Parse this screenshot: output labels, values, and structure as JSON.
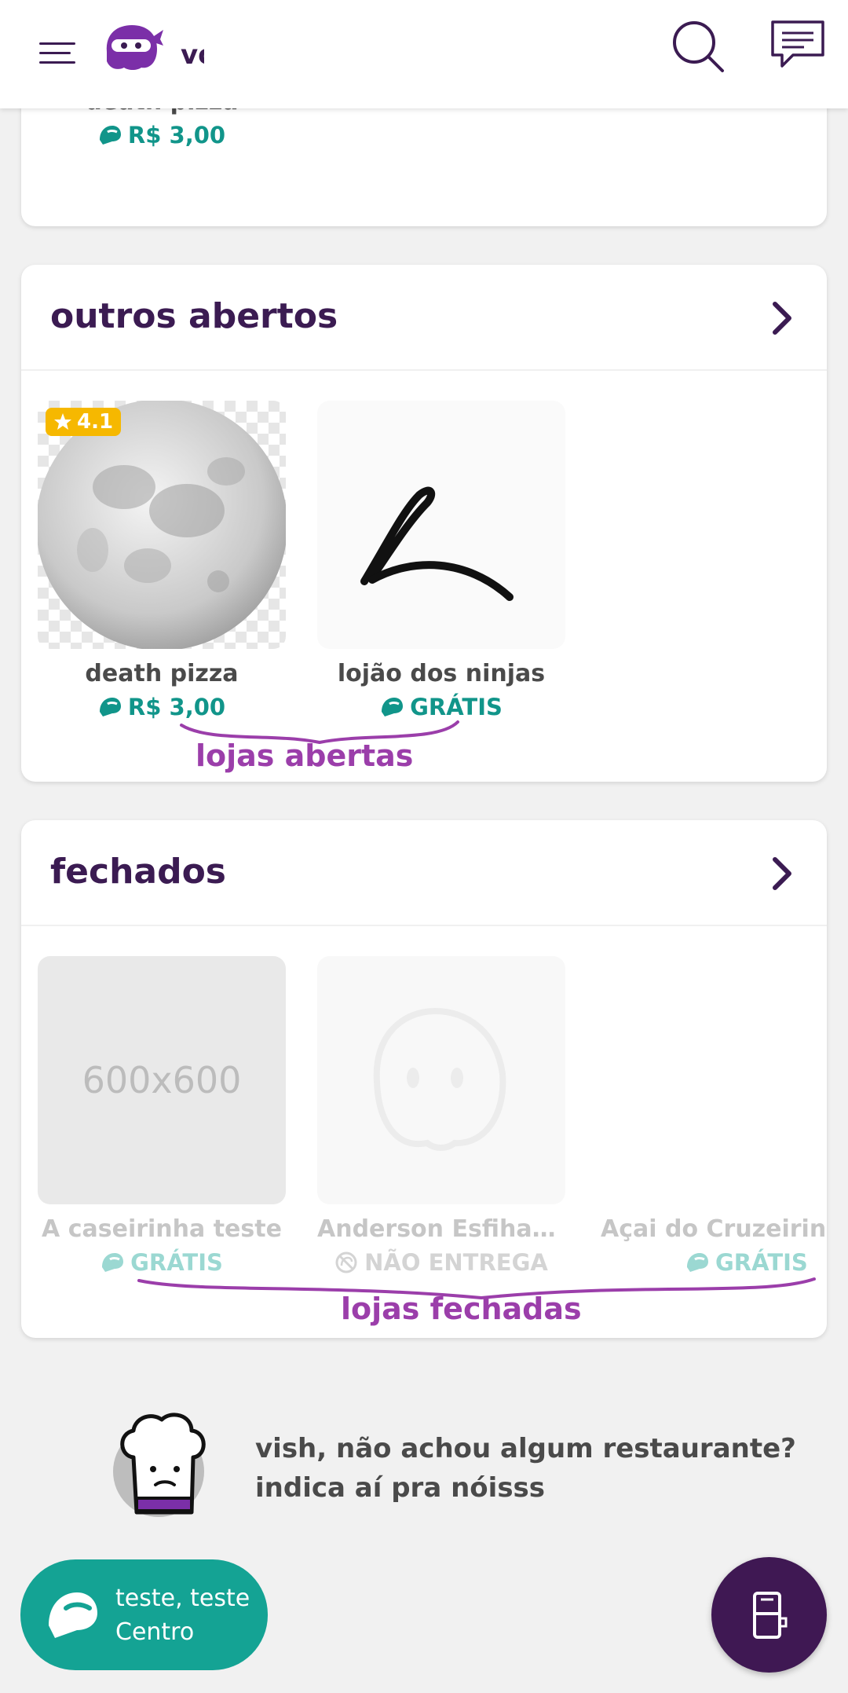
{
  "header": {
    "brand_text": "vo",
    "menu_icon": "hamburger-menu-icon",
    "logo_icon": "ninja-logo-icon",
    "search_icon": "search-icon",
    "chat_icon": "chat-icon"
  },
  "top_section": {
    "stores": [
      {
        "name": "death pizza",
        "fee": "R$ 3,00",
        "fee_icon": "helmet-icon"
      }
    ]
  },
  "open_section": {
    "title": "outros abertos",
    "stores": [
      {
        "name": "death pizza",
        "fee": "R$ 3,00",
        "rating": "4.1",
        "fee_icon": "helmet-icon"
      },
      {
        "name": "lojão dos ninjas",
        "fee": "GRÁTIS",
        "fee_icon": "helmet-icon"
      }
    ],
    "annotation": "lojas abertas"
  },
  "closed_section": {
    "title": "fechados",
    "stores": [
      {
        "name": "A caseirinha teste",
        "fee": "GRÁTIS",
        "image_text": "600x600",
        "fee_icon": "helmet-icon"
      },
      {
        "name": "Anderson Esfihari...",
        "fee": "NÃO ENTREGA",
        "fee_icon": "no-delivery-icon"
      },
      {
        "name": "Açai do Cruzeirinho",
        "fee": "GRÁTIS",
        "fee_icon": "helmet-icon"
      }
    ],
    "annotation": "lojas fechadas"
  },
  "empty_state": {
    "line1": "vish, não achou algum restaurante?",
    "line2": "indica aí pra nóisss"
  },
  "address_button": {
    "line1": "teste, teste",
    "line2": "Centro"
  },
  "colors": {
    "primary": "#3b1b52",
    "accent_teal": "#14a394",
    "rating": "#f6b800",
    "annotation": "#9b3eaa"
  }
}
